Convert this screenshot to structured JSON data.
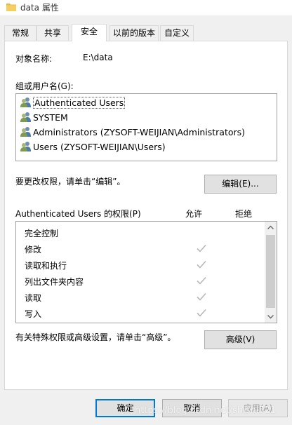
{
  "window": {
    "title": "data 属性"
  },
  "tabs": [
    {
      "label": "常规"
    },
    {
      "label": "共享"
    },
    {
      "label": "安全"
    },
    {
      "label": "以前的版本"
    },
    {
      "label": "自定义"
    }
  ],
  "object": {
    "label": "对象名称:",
    "value": "E:\\data"
  },
  "groups": {
    "label": "组或用户名(G):",
    "items": [
      {
        "label": "Authenticated Users"
      },
      {
        "label": "SYSTEM"
      },
      {
        "label": "Administrators (ZYSOFT-WEIJIAN\\Administrators)"
      },
      {
        "label": "Users (ZYSOFT-WEIJIAN\\Users)"
      }
    ]
  },
  "edit": {
    "hint": "要更改权限，请单击“编辑”。",
    "button_label": "编辑(E)..."
  },
  "permissions": {
    "header_label": "Authenticated Users 的权限(P)",
    "allow_label": "允许",
    "deny_label": "拒绝",
    "items": [
      {
        "label": "完全控制",
        "allow": false
      },
      {
        "label": "修改",
        "allow": true
      },
      {
        "label": "读取和执行",
        "allow": true
      },
      {
        "label": "列出文件夹内容",
        "allow": true
      },
      {
        "label": "读取",
        "allow": true
      },
      {
        "label": "写入",
        "allow": true
      }
    ]
  },
  "advanced": {
    "hint": "有关特殊权限或高级设置，请单击“高级”。",
    "button_label": "高级(V)"
  },
  "footer": {
    "ok_label": "确定",
    "cancel_label": "取消",
    "apply_label": "应用(A)"
  },
  "watermark": "https://blog.csdn.net/shishi521",
  "colors": {
    "focus_border": "#0078d7",
    "check": "#b8b8b8",
    "panel_bg": "#ffffff",
    "dialog_bg": "#f0f0f0"
  }
}
